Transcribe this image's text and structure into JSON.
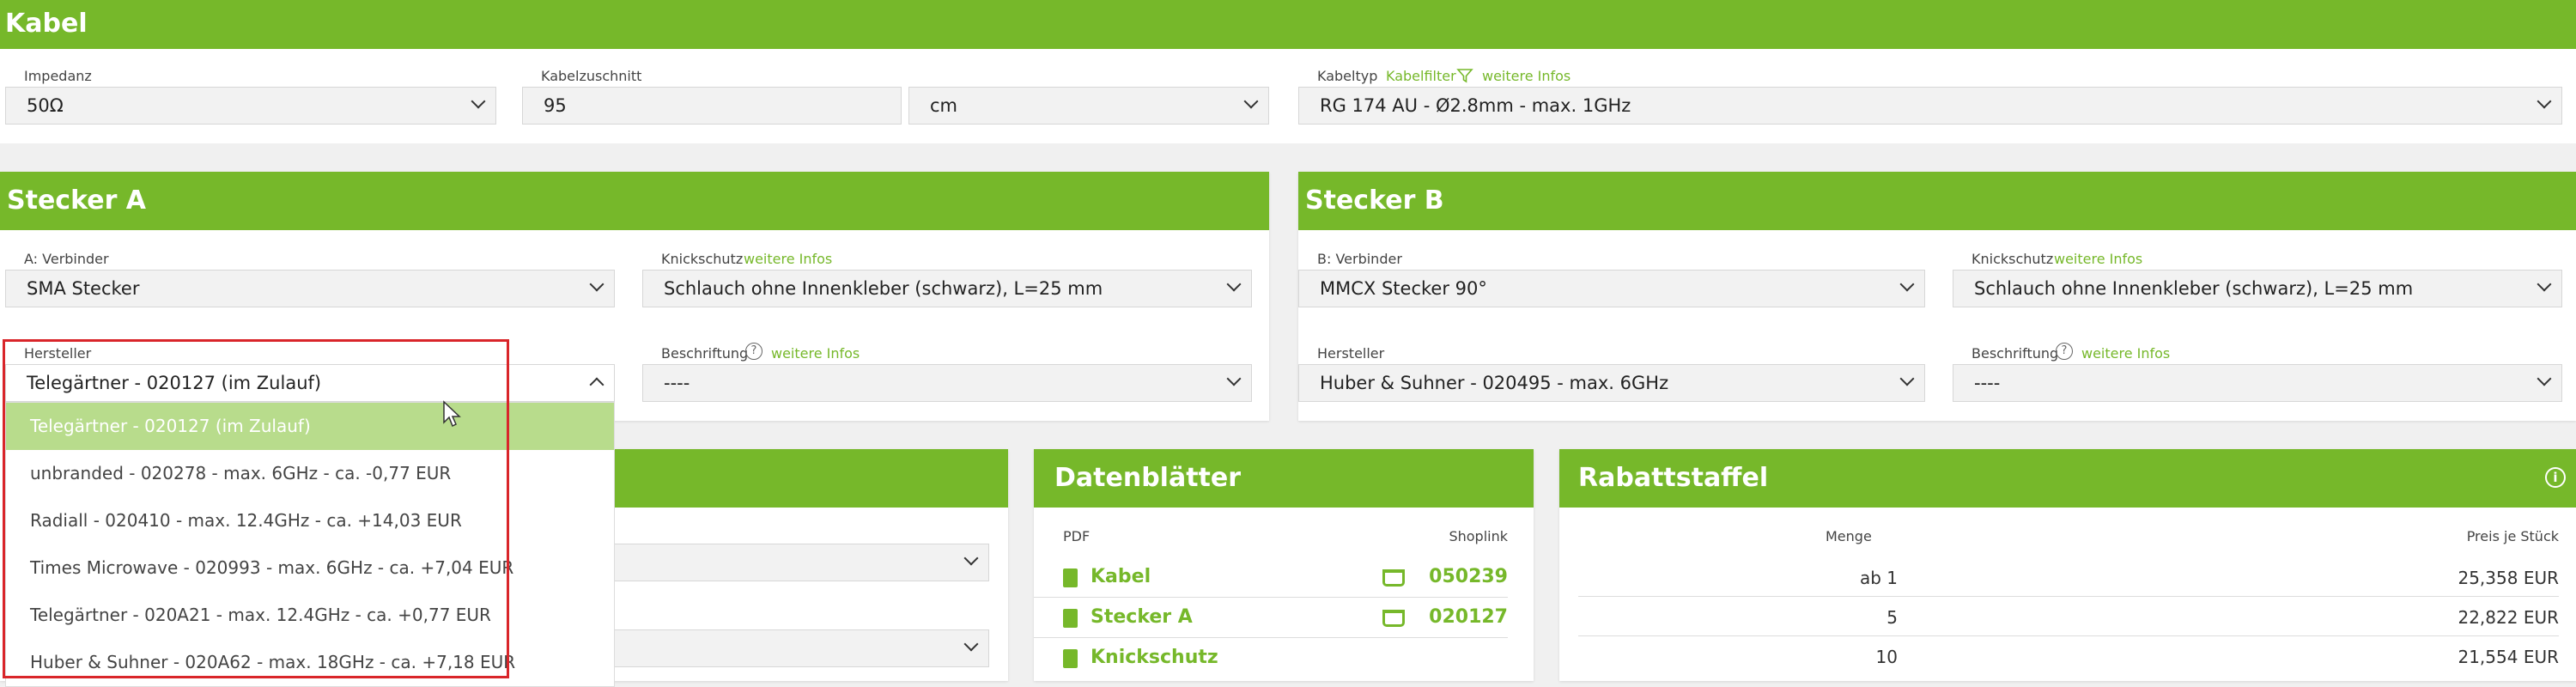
{
  "kabel": {
    "title": "Kabel",
    "impedanz_label": "Impedanz",
    "impedanz_value": "50Ω",
    "kabelzuschnitt_label": "Kabelzuschnitt",
    "kabelzuschnitt_value": "95",
    "unit_value": "cm",
    "kabeltyp_label": "Kabeltyp",
    "kabelfilter_link": "Kabelfilter",
    "weitere_infos": "weitere Infos",
    "kabeltyp_value": "RG 174 AU - Ø2.8mm - max. 1GHz"
  },
  "stecker_a": {
    "title": "Stecker A",
    "verbinder_label": "A: Verbinder",
    "verbinder_value": "SMA Stecker",
    "knickschutz_label": "Knickschutz",
    "weitere_infos": "weitere Infos",
    "knickschutz_value": "Schlauch ohne Innenkleber (schwarz), L=25 mm",
    "hersteller_label": "Hersteller",
    "hersteller_value": "Telegärtner - 020127 (im Zulauf)",
    "beschriftung_label": "Beschriftung",
    "beschriftung_value": "----",
    "dropdown_options": [
      "Telegärtner - 020127 (im Zulauf)",
      "unbranded - 020278 - max. 6GHz - ca. -0,77 EUR",
      "Radiall - 020410 - max. 12.4GHz - ca. +14,03 EUR",
      "Times Microwave - 020993 - max. 6GHz - ca. +7,04 EUR",
      "Telegärtner - 020A21 - max. 12.4GHz - ca. +0,77 EUR",
      "Huber & Suhner - 020A62 - max. 18GHz - ca. +7,18 EUR"
    ]
  },
  "stecker_b": {
    "title": "Stecker B",
    "verbinder_label": "B: Verbinder",
    "verbinder_value": "MMCX Stecker 90°",
    "knickschutz_label": "Knickschutz",
    "weitere_infos": "weitere Infos",
    "knickschutz_value": "Schlauch ohne Innenkleber (schwarz), L=25 mm",
    "hersteller_label": "Hersteller",
    "hersteller_value": "Huber & Suhner - 020495 - max. 6GHz",
    "beschriftung_label": "Beschriftung",
    "beschriftung_value": "----"
  },
  "datenblaetter": {
    "title": "Datenblätter",
    "col_pdf": "PDF",
    "col_shop": "Shoplink",
    "rows": [
      {
        "pdf": "Kabel",
        "shop": "050239"
      },
      {
        "pdf": "Stecker A",
        "shop": "020127"
      },
      {
        "pdf": "Knickschutz",
        "shop": ""
      }
    ]
  },
  "rabattstaffel": {
    "title": "Rabattstaffel",
    "col_menge": "Menge",
    "col_preis": "Preis je Stück",
    "rows": [
      {
        "menge": "ab 1",
        "preis": "25,358 EUR"
      },
      {
        "menge": "5",
        "preis": "22,822 EUR"
      },
      {
        "menge": "10",
        "preis": "21,554 EUR"
      }
    ]
  },
  "colors": {
    "accent": "#76b82a",
    "highlight": "#b8dc8c",
    "dropdown_border": "#d9252a"
  }
}
